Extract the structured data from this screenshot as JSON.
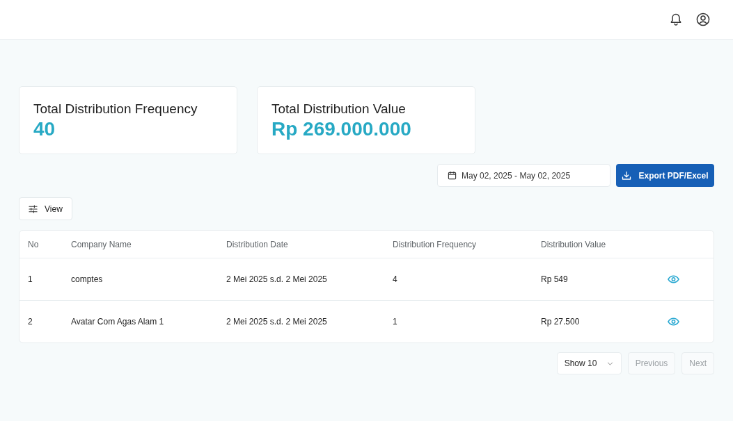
{
  "summary_cards": [
    {
      "label": "Total Distribution Frequency",
      "value": "40"
    },
    {
      "label": "Total Distribution Value",
      "value": "Rp 269.000.000"
    }
  ],
  "date_range": {
    "value": "May 02, 2025 - May 02, 2025"
  },
  "export_button": {
    "label": "Export PDF/Excel"
  },
  "view_button": {
    "label": "View"
  },
  "table": {
    "columns": [
      "No",
      "Company Name",
      "Distribution Date",
      "Distribution Frequency",
      "Distribution Value"
    ],
    "rows": [
      {
        "cells": [
          "1",
          "comptes",
          "2 Mei 2025 s.d. 2 Mei 2025",
          "4",
          "Rp 549"
        ]
      },
      {
        "cells": [
          "2",
          "Avatar Com Agas Alam 1",
          "2 Mei 2025 s.d. 2 Mei 2025",
          "1",
          "Rp 27.500"
        ]
      }
    ]
  },
  "pagination": {
    "page_size": "Show 10",
    "buttons": [
      {
        "label": "Previous",
        "disabled": true
      },
      {
        "label": "Next",
        "disabled": true
      }
    ]
  }
}
